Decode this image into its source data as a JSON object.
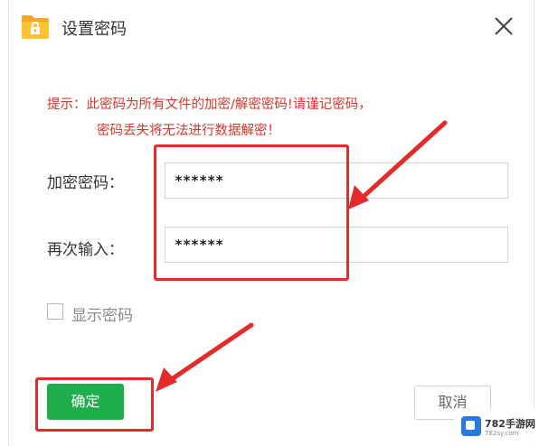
{
  "window": {
    "title": "设置密码",
    "icon": "folder-lock-icon",
    "close_icon": "close-icon"
  },
  "warning": {
    "line1": "提示：此密码为所有文件的加密/解密密码!请谨记密码，",
    "line2": "密码丢失将无法进行数据解密！"
  },
  "form": {
    "encrypt_label": "加密密码：",
    "encrypt_value": "******",
    "confirm_label": "再次输入：",
    "confirm_value": "******",
    "show_password_label": "显示密码",
    "show_password_checked": false
  },
  "buttons": {
    "ok_label": "确定",
    "cancel_label": "取消"
  },
  "watermark": {
    "text": "782手游网",
    "sub": "782sy.com"
  },
  "colors": {
    "warning": "#d9372b",
    "ok_button": "#20ad4b",
    "annotation": "#e52a2a"
  }
}
